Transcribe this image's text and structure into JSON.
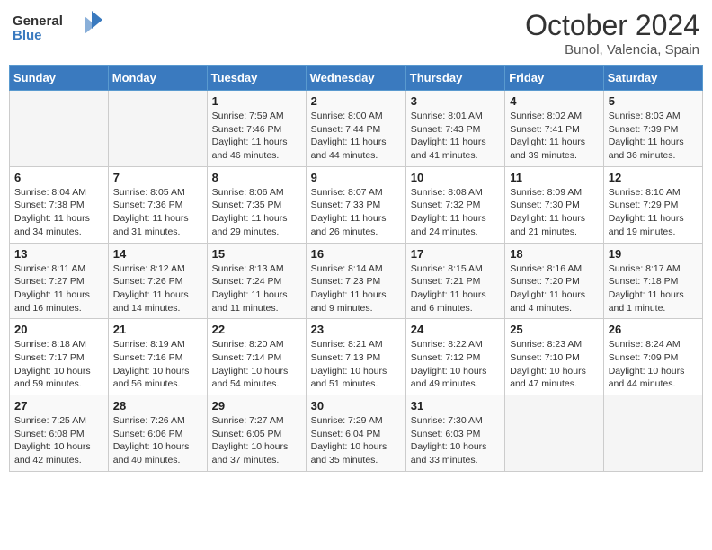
{
  "app": {
    "name": "GeneralBlue",
    "logo_symbol": "▶"
  },
  "title": "October 2024",
  "subtitle": "Bunol, Valencia, Spain",
  "days_of_week": [
    "Sunday",
    "Monday",
    "Tuesday",
    "Wednesday",
    "Thursday",
    "Friday",
    "Saturday"
  ],
  "weeks": [
    [
      {
        "num": "",
        "info": ""
      },
      {
        "num": "",
        "info": ""
      },
      {
        "num": "1",
        "info": "Sunrise: 7:59 AM\nSunset: 7:46 PM\nDaylight: 11 hours and 46 minutes."
      },
      {
        "num": "2",
        "info": "Sunrise: 8:00 AM\nSunset: 7:44 PM\nDaylight: 11 hours and 44 minutes."
      },
      {
        "num": "3",
        "info": "Sunrise: 8:01 AM\nSunset: 7:43 PM\nDaylight: 11 hours and 41 minutes."
      },
      {
        "num": "4",
        "info": "Sunrise: 8:02 AM\nSunset: 7:41 PM\nDaylight: 11 hours and 39 minutes."
      },
      {
        "num": "5",
        "info": "Sunrise: 8:03 AM\nSunset: 7:39 PM\nDaylight: 11 hours and 36 minutes."
      }
    ],
    [
      {
        "num": "6",
        "info": "Sunrise: 8:04 AM\nSunset: 7:38 PM\nDaylight: 11 hours and 34 minutes."
      },
      {
        "num": "7",
        "info": "Sunrise: 8:05 AM\nSunset: 7:36 PM\nDaylight: 11 hours and 31 minutes."
      },
      {
        "num": "8",
        "info": "Sunrise: 8:06 AM\nSunset: 7:35 PM\nDaylight: 11 hours and 29 minutes."
      },
      {
        "num": "9",
        "info": "Sunrise: 8:07 AM\nSunset: 7:33 PM\nDaylight: 11 hours and 26 minutes."
      },
      {
        "num": "10",
        "info": "Sunrise: 8:08 AM\nSunset: 7:32 PM\nDaylight: 11 hours and 24 minutes."
      },
      {
        "num": "11",
        "info": "Sunrise: 8:09 AM\nSunset: 7:30 PM\nDaylight: 11 hours and 21 minutes."
      },
      {
        "num": "12",
        "info": "Sunrise: 8:10 AM\nSunset: 7:29 PM\nDaylight: 11 hours and 19 minutes."
      }
    ],
    [
      {
        "num": "13",
        "info": "Sunrise: 8:11 AM\nSunset: 7:27 PM\nDaylight: 11 hours and 16 minutes."
      },
      {
        "num": "14",
        "info": "Sunrise: 8:12 AM\nSunset: 7:26 PM\nDaylight: 11 hours and 14 minutes."
      },
      {
        "num": "15",
        "info": "Sunrise: 8:13 AM\nSunset: 7:24 PM\nDaylight: 11 hours and 11 minutes."
      },
      {
        "num": "16",
        "info": "Sunrise: 8:14 AM\nSunset: 7:23 PM\nDaylight: 11 hours and 9 minutes."
      },
      {
        "num": "17",
        "info": "Sunrise: 8:15 AM\nSunset: 7:21 PM\nDaylight: 11 hours and 6 minutes."
      },
      {
        "num": "18",
        "info": "Sunrise: 8:16 AM\nSunset: 7:20 PM\nDaylight: 11 hours and 4 minutes."
      },
      {
        "num": "19",
        "info": "Sunrise: 8:17 AM\nSunset: 7:18 PM\nDaylight: 11 hours and 1 minute."
      }
    ],
    [
      {
        "num": "20",
        "info": "Sunrise: 8:18 AM\nSunset: 7:17 PM\nDaylight: 10 hours and 59 minutes."
      },
      {
        "num": "21",
        "info": "Sunrise: 8:19 AM\nSunset: 7:16 PM\nDaylight: 10 hours and 56 minutes."
      },
      {
        "num": "22",
        "info": "Sunrise: 8:20 AM\nSunset: 7:14 PM\nDaylight: 10 hours and 54 minutes."
      },
      {
        "num": "23",
        "info": "Sunrise: 8:21 AM\nSunset: 7:13 PM\nDaylight: 10 hours and 51 minutes."
      },
      {
        "num": "24",
        "info": "Sunrise: 8:22 AM\nSunset: 7:12 PM\nDaylight: 10 hours and 49 minutes."
      },
      {
        "num": "25",
        "info": "Sunrise: 8:23 AM\nSunset: 7:10 PM\nDaylight: 10 hours and 47 minutes."
      },
      {
        "num": "26",
        "info": "Sunrise: 8:24 AM\nSunset: 7:09 PM\nDaylight: 10 hours and 44 minutes."
      }
    ],
    [
      {
        "num": "27",
        "info": "Sunrise: 7:25 AM\nSunset: 6:08 PM\nDaylight: 10 hours and 42 minutes."
      },
      {
        "num": "28",
        "info": "Sunrise: 7:26 AM\nSunset: 6:06 PM\nDaylight: 10 hours and 40 minutes."
      },
      {
        "num": "29",
        "info": "Sunrise: 7:27 AM\nSunset: 6:05 PM\nDaylight: 10 hours and 37 minutes."
      },
      {
        "num": "30",
        "info": "Sunrise: 7:29 AM\nSunset: 6:04 PM\nDaylight: 10 hours and 35 minutes."
      },
      {
        "num": "31",
        "info": "Sunrise: 7:30 AM\nSunset: 6:03 PM\nDaylight: 10 hours and 33 minutes."
      },
      {
        "num": "",
        "info": ""
      },
      {
        "num": "",
        "info": ""
      }
    ]
  ]
}
